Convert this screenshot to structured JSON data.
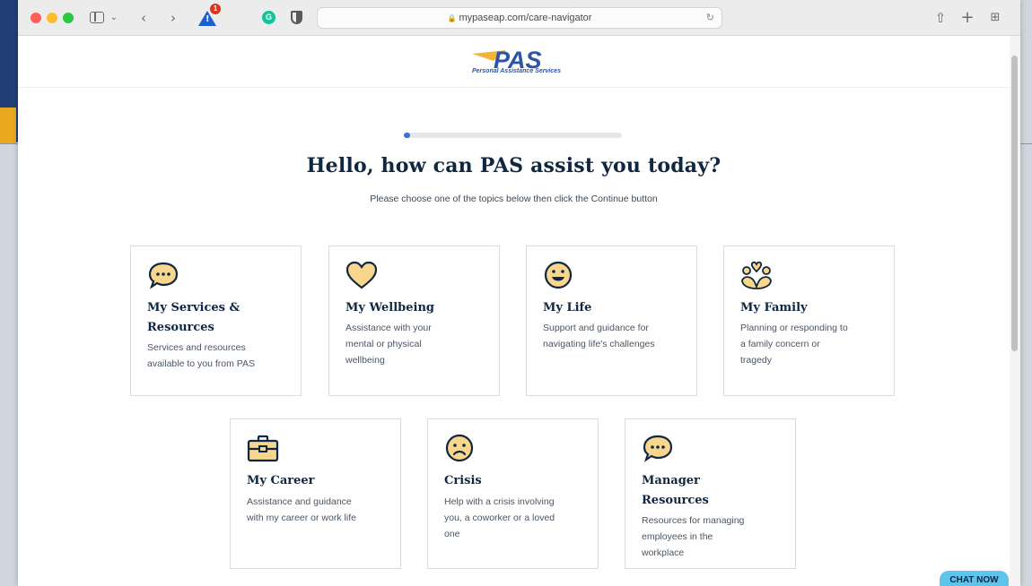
{
  "browser": {
    "url": "mypaseap.com/care-navigator",
    "alert_count": "1",
    "grammarly_label": "G"
  },
  "header": {
    "logo_wordmark": "PAS",
    "logo_tagline": "Personal Assistance Services"
  },
  "progress": {
    "fraction": 0.02
  },
  "main": {
    "headline": "Hello, how can PAS assist you today?",
    "subline": "Please choose one of the topics below then click the Continue button"
  },
  "cards": [
    {
      "title_lines": [
        "My Services &",
        "Resources"
      ],
      "desc": [
        "Services and resources",
        "available to you from PAS"
      ],
      "icon": "chat-bubble-icon"
    },
    {
      "title_lines": [
        "My Wellbeing"
      ],
      "desc": [
        "Assistance with your",
        "mental or physical",
        "wellbeing"
      ],
      "icon": "heart-icon"
    },
    {
      "title_lines": [
        "My Life"
      ],
      "desc": [
        "Support and guidance for",
        "navigating life's challenges"
      ],
      "icon": "smiley-face-icon"
    },
    {
      "title_lines": [
        "My Family"
      ],
      "desc": [
        "Planning or responding to",
        "a family concern or",
        "tragedy"
      ],
      "icon": "family-heart-icon"
    },
    {
      "title_lines": [
        "My Career"
      ],
      "desc": [
        "Assistance and guidance",
        "with my career or work life"
      ],
      "icon": "briefcase-icon"
    },
    {
      "title_lines": [
        "Crisis"
      ],
      "desc": [
        "Help with a crisis involving",
        "you, a coworker or a loved",
        "one"
      ],
      "icon": "worried-face-icon"
    },
    {
      "title_lines": [
        "Manager",
        "Resources"
      ],
      "desc": [
        "Resources for managing",
        "employees in the",
        "workplace"
      ],
      "icon": "chat-bubble-icon"
    }
  ],
  "chat": {
    "label": "CHAT NOW"
  },
  "colors": {
    "accent": "#3e6fce",
    "heading": "#0f2741",
    "icon_fill": "#f8d68d"
  }
}
